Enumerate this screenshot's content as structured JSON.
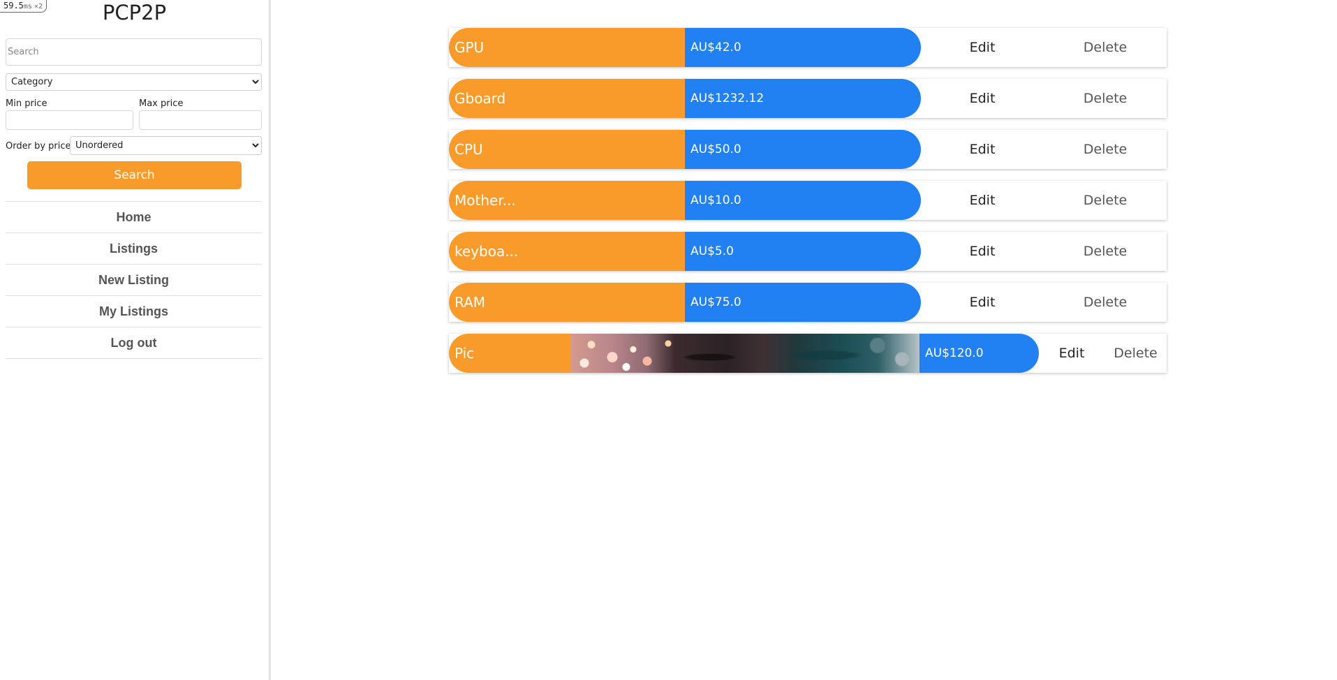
{
  "perf": {
    "value": "59.5",
    "unit": "ms",
    "multiplier": "×2"
  },
  "sidebar": {
    "brand": "PCP2P",
    "search_placeholder": "Search",
    "category": {
      "selected": "Category"
    },
    "min_price_label": "Min price",
    "max_price_label": "Max price",
    "order_label": "Order by price",
    "order": {
      "selected": "Unordered"
    },
    "search_button": "Search",
    "nav": [
      {
        "label": "Home"
      },
      {
        "label": "Listings"
      },
      {
        "label": "New Listing"
      },
      {
        "label": "My Listings"
      },
      {
        "label": "Log out"
      }
    ]
  },
  "colors": {
    "name_bg": "#f89b2b",
    "price_bg": "#2181f2",
    "search_button_bg": "#f89b2b"
  },
  "listings": [
    {
      "name": "GPU",
      "price": "AU$42.0",
      "edit": "Edit",
      "delete": "Delete"
    },
    {
      "name": "Gboard",
      "price": "AU$1232.12",
      "edit": "Edit",
      "delete": "Delete"
    },
    {
      "name": "CPU",
      "price": "AU$50.0",
      "edit": "Edit",
      "delete": "Delete"
    },
    {
      "name": "Mother...",
      "price": "AU$10.0",
      "edit": "Edit",
      "delete": "Delete"
    },
    {
      "name": "keyboa...",
      "price": "AU$5.0",
      "edit": "Edit",
      "delete": "Delete"
    },
    {
      "name": "RAM",
      "price": "AU$75.0",
      "edit": "Edit",
      "delete": "Delete"
    },
    {
      "name": "Pic",
      "price": "AU$120.0",
      "edit": "Edit",
      "delete": "Delete"
    }
  ]
}
